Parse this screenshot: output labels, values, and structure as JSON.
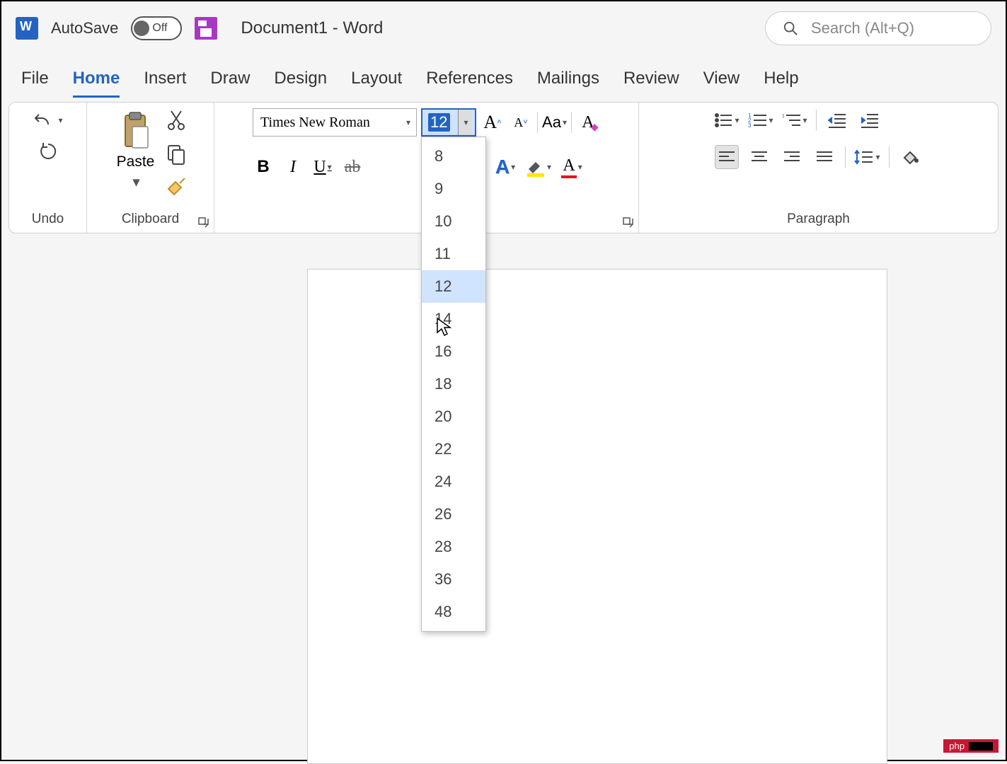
{
  "title": {
    "autosave": "AutoSave",
    "autosave_state": "Off",
    "doc": "Document1  -  Word"
  },
  "search": {
    "placeholder": "Search (Alt+Q)"
  },
  "tabs": {
    "file": "File",
    "home": "Home",
    "insert": "Insert",
    "draw": "Draw",
    "design": "Design",
    "layout": "Layout",
    "references": "References",
    "mailings": "Mailings",
    "review": "Review",
    "view": "View",
    "help": "Help"
  },
  "ribbon": {
    "undo_label": "Undo",
    "clipboard_label": "Clipboard",
    "paste": "Paste",
    "paragraph_label": "Paragraph",
    "font_name": "Times New Roman",
    "font_size": "12",
    "case_btn": "Aa",
    "bold": "B",
    "italic": "I",
    "underline": "U",
    "strike": "ab",
    "text_effect": "A",
    "highlight": "",
    "font_color": "A"
  },
  "font_sizes": [
    "8",
    "9",
    "10",
    "11",
    "12",
    "14",
    "16",
    "18",
    "20",
    "22",
    "24",
    "26",
    "28",
    "36",
    "48"
  ],
  "selected_size": "12",
  "watermark": "php"
}
